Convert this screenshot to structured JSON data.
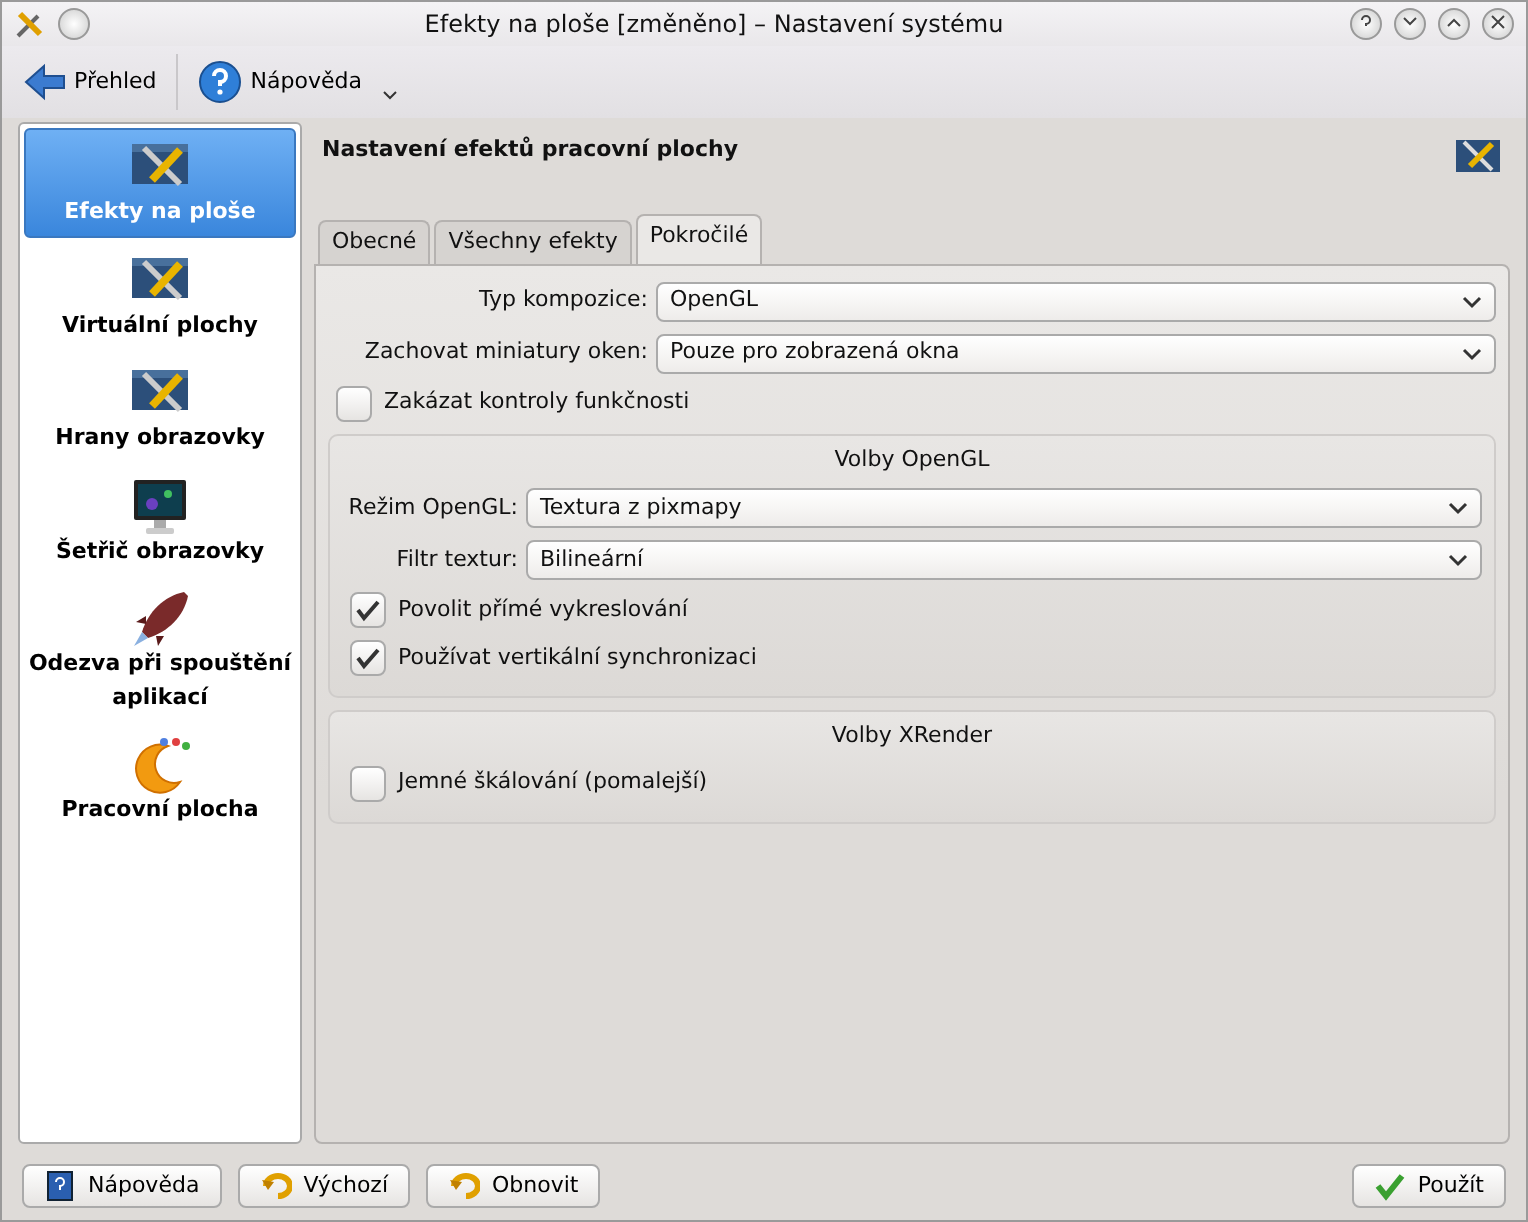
{
  "window": {
    "title": "Efekty na ploše [změněno] – Nastavení systému"
  },
  "toolbar": [
    {
      "kind": "back",
      "label": "Přehled"
    },
    {
      "kind": "help",
      "label": "Nápověda"
    }
  ],
  "sidebar": {
    "items": [
      {
        "kind": "effects",
        "label": "Efekty na ploše",
        "selected": true
      },
      {
        "kind": "effects",
        "label": "Virtuální plochy",
        "selected": false
      },
      {
        "kind": "effects",
        "label": "Hrany obrazovky",
        "selected": false
      },
      {
        "kind": "monitor",
        "label": "Šetřič obrazovky",
        "selected": false
      },
      {
        "kind": "rocket",
        "label": "Odezva při spouštění aplikací",
        "selected": false
      },
      {
        "kind": "desktop",
        "label": "Pracovní plocha",
        "selected": false
      }
    ]
  },
  "header": {
    "title": "Nastavení efektů pracovní plochy"
  },
  "tabs": [
    {
      "label": "Obecné",
      "selected": false
    },
    {
      "label": "Všechny efekty",
      "selected": false
    },
    {
      "label": "Pokročilé",
      "selected": true
    }
  ],
  "fields": [
    {
      "label": "Typ kompozice:",
      "value": "OpenGL"
    },
    {
      "label": "Zachovat miniatury oken:",
      "value": "Pouze pro zobrazená okna"
    }
  ],
  "disable_checks": {
    "label": "Zakázat kontroly funkčnosti",
    "checked": false
  },
  "groups": [
    {
      "title": "Volby OpenGL",
      "fields": [
        {
          "label": "Režim OpenGL:",
          "value": "Textura z pixmapy"
        },
        {
          "label": "Filtr textur:",
          "value": "Bilineární"
        }
      ],
      "checkboxes": [
        {
          "label": "Povolit přímé vykreslování",
          "checked": true
        },
        {
          "label": "Používat vertikální synchronizaci",
          "checked": true
        }
      ]
    },
    {
      "title": "Volby XRender",
      "checkboxes": [
        {
          "label": "Jemné škálování (pomalejší)",
          "checked": false
        }
      ]
    }
  ],
  "buttons": [
    {
      "kind": "help",
      "label": "Nápověda"
    },
    {
      "kind": "undo",
      "label": "Výchozí"
    },
    {
      "kind": "undo",
      "label": "Obnovit"
    },
    {
      "kind": "apply",
      "label": "Použít"
    }
  ]
}
